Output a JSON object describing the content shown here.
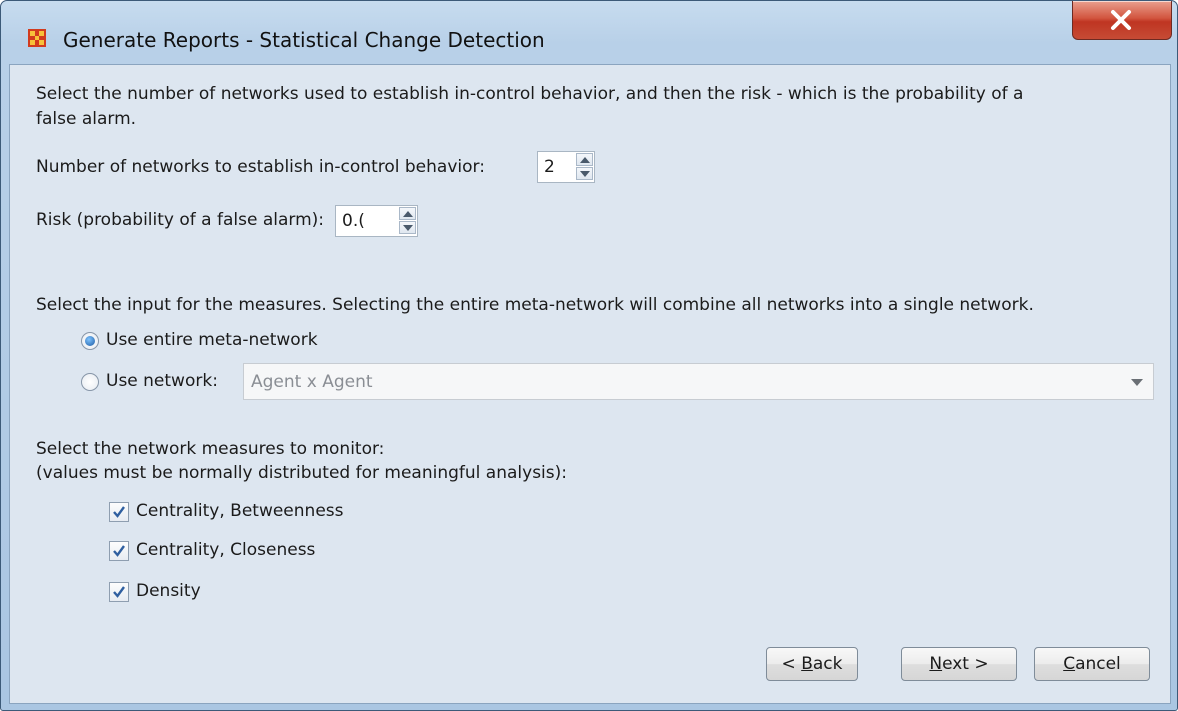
{
  "window": {
    "title": "Generate Reports - Statistical Change Detection",
    "icon": "app-grid-icon",
    "close_icon": "close-icon",
    "accent_color": "#c7462f"
  },
  "intro": {
    "line1": "Select the number of networks used to establish in-control behavior, and then the risk - which is the probability of a",
    "line2": "false alarm."
  },
  "networks_count": {
    "label": "Number of networks to establish in-control behavior:",
    "value": "2"
  },
  "risk": {
    "label": "Risk (probability of a false alarm):",
    "value": "0.("
  },
  "input_section": {
    "instruction": "Select the input for the measures. Selecting the entire meta-network will combine all networks into a single network.",
    "option_entire": "Use entire meta-network",
    "option_network": "Use network:",
    "network_value": "Agent x Agent",
    "selected": "entire"
  },
  "measures_section": {
    "instruction_line1": "Select the network measures to monitor:",
    "instruction_line2": "(values must be normally distributed for meaningful analysis):",
    "items": [
      {
        "label": "Centrality, Betweenness",
        "checked": true
      },
      {
        "label": "Centrality, Closeness",
        "checked": true
      },
      {
        "label": "Density",
        "checked": true
      }
    ]
  },
  "buttons": {
    "back": {
      "prefix": "< ",
      "mnemonic": "B",
      "rest": "ack"
    },
    "next": {
      "prefix": "",
      "mnemonic": "N",
      "rest": "ext >"
    },
    "cancel": {
      "prefix": "",
      "mnemonic": "C",
      "rest": "ancel"
    }
  }
}
